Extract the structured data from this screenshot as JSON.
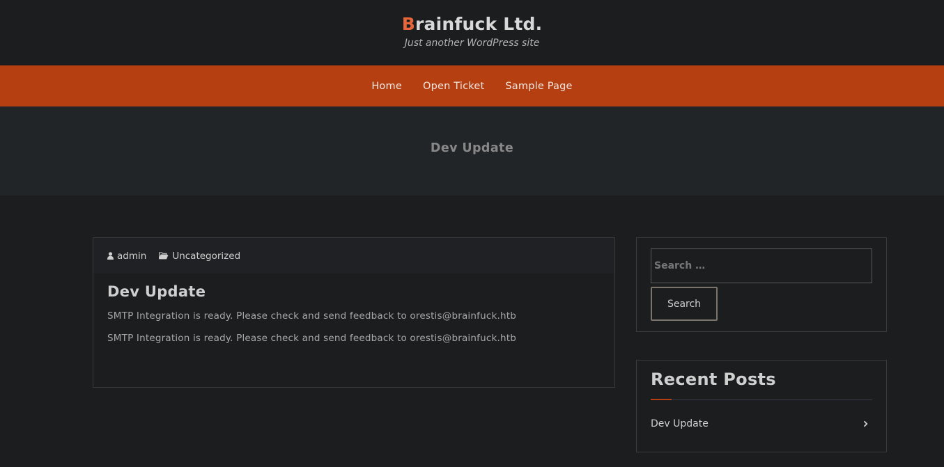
{
  "site": {
    "title_first_letter": "B",
    "title_rest": "rainfuck Ltd.",
    "tagline": "Just another WordPress site",
    "accent_color": "#e8663c"
  },
  "nav": {
    "bar_color": "#b63f11",
    "items": [
      {
        "label": "Home"
      },
      {
        "label": "Open Ticket"
      },
      {
        "label": "Sample Page"
      }
    ]
  },
  "banner": {
    "title": "Dev Update"
  },
  "post": {
    "author": "admin",
    "author_icon": "user-icon",
    "category": "Uncategorized",
    "category_icon": "folder-open-icon",
    "title": "Dev Update",
    "paragraphs": [
      "SMTP Integration is ready. Please check and send feedback to orestis@brainfuck.htb",
      "SMTP Integration is ready. Please check and send feedback to orestis@brainfuck.htb"
    ]
  },
  "sidebar": {
    "search": {
      "placeholder": "Search …",
      "value": "",
      "button_label": "Search"
    },
    "recent_posts": {
      "title": "Recent Posts",
      "items": [
        {
          "label": "Dev Update",
          "icon": "chevron-right-icon"
        }
      ]
    }
  }
}
